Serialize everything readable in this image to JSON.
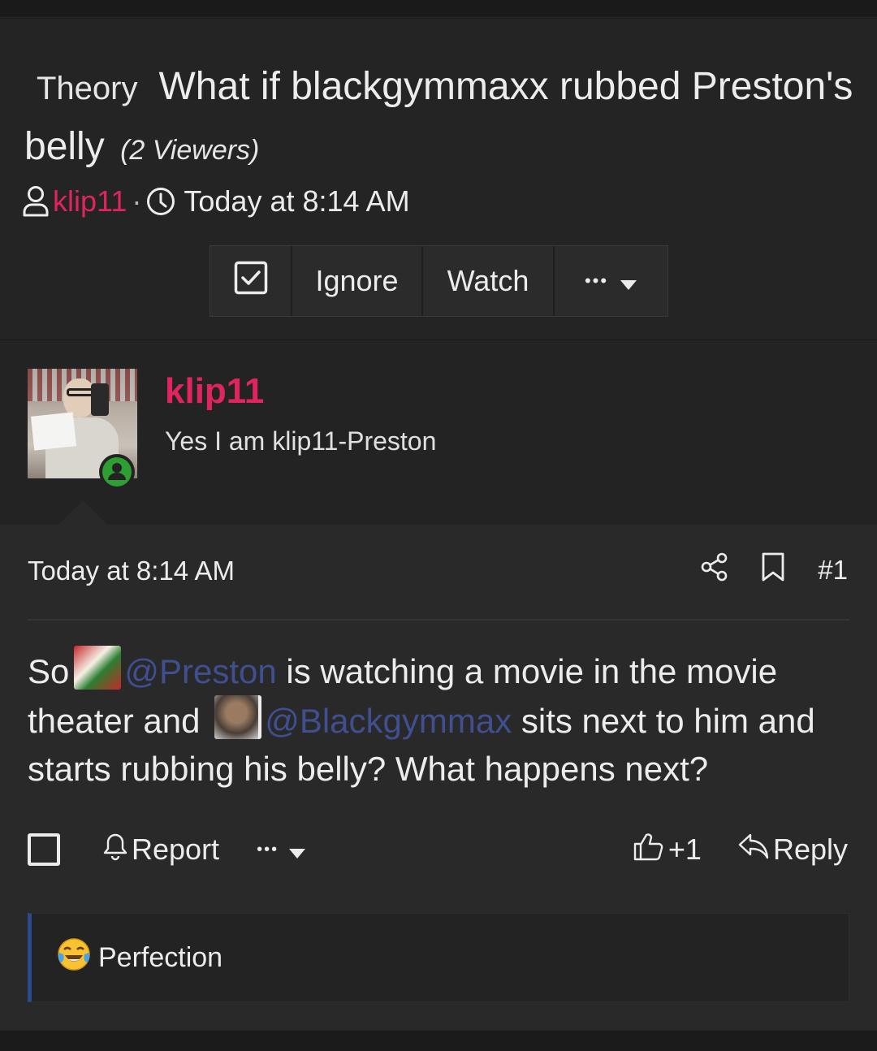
{
  "thread": {
    "prefix": "Theory",
    "title": "What if blackgymmaxx rubbed Preston's belly",
    "viewers": "(2 Viewers)",
    "author": "klip11",
    "separator": "·",
    "date": "Today at 8:14 AM",
    "actions": {
      "ignore": "Ignore",
      "watch": "Watch",
      "more": "•••"
    }
  },
  "post": {
    "author": "klip11",
    "user_title": "Yes I am klip11-Preston",
    "date": "Today at 8:14 AM",
    "number": "#1",
    "message": {
      "p1": "So",
      "mention1": "@Preston",
      "p2": " is watching a movie in the movie theater and",
      "mention2": "@Blackgymmax",
      "p3": " sits next to him and starts rubbing his belly? What happens next?"
    },
    "footer": {
      "report": "Report",
      "more": "•••",
      "likes": "+1",
      "reply": "Reply"
    },
    "reaction": {
      "text": "Perfection",
      "icon": "crying-laughing-emoji-icon"
    }
  },
  "colors": {
    "accent_username": "#e0245e",
    "mention": "#3f4f8f",
    "online": "#2e9e32",
    "reaction_border": "#2d4a8f"
  }
}
